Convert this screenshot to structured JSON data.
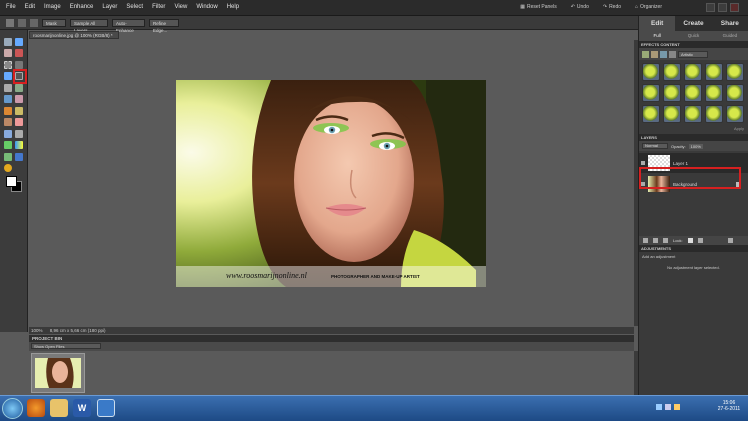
{
  "menu": {
    "items": [
      "File",
      "Edit",
      "Image",
      "Enhance",
      "Layer",
      "Select",
      "Filter",
      "View",
      "Window",
      "Help"
    ],
    "reset_panels": "Reset Panels",
    "undo": "Undo",
    "redo": "Redo",
    "organizer": "Organizer"
  },
  "options_bar": {
    "mode": "Mask",
    "sample_all_layers": "Sample All Layers",
    "auto_enhance": "Auto-Enhance",
    "refine_edge": "Refine Edge..."
  },
  "document": {
    "tab_title": "roosmarijnonline.jpg @ 100% (RGB/8) *",
    "zoom": "100%",
    "doc_info": "8,96 cm x 5,66 cm (180 ppi)"
  },
  "photo": {
    "watermark_site": "www.roosmarijnonline.nl",
    "watermark_tag": "PHOTOGRAPHER AND MAKE-UP ARTIST"
  },
  "project_bin": {
    "title": "PROJECT BIN",
    "filter": "Show Open Files"
  },
  "right_panel": {
    "tabs": [
      "Edit",
      "Create",
      "Share"
    ],
    "subtabs": [
      "Full",
      "Quick",
      "Guided"
    ],
    "effects_header": "EFFECTS  CONTENT",
    "effects_filter": "Artistic",
    "apply": "Apply",
    "layers_header": "LAYERS",
    "blend_mode": "Normal",
    "opacity_label": "Opacity:",
    "opacity_value": "100%",
    "layers": [
      {
        "name": "Layer 1",
        "selected": true
      },
      {
        "name": "Background",
        "selected": false,
        "locked": true
      }
    ],
    "lock_label": "Lock:",
    "adjustments_header": "ADJUSTMENTS",
    "add_adjustment": "Add an adjustment",
    "no_adjustment": "No adjustment layer selected."
  },
  "taskbar": {
    "time": "15:06",
    "date": "27-6-2011"
  },
  "colors": {
    "highlight": "#d62020",
    "panel_bg": "#3a3a3a",
    "canvas_bg": "#5a5a5a"
  }
}
